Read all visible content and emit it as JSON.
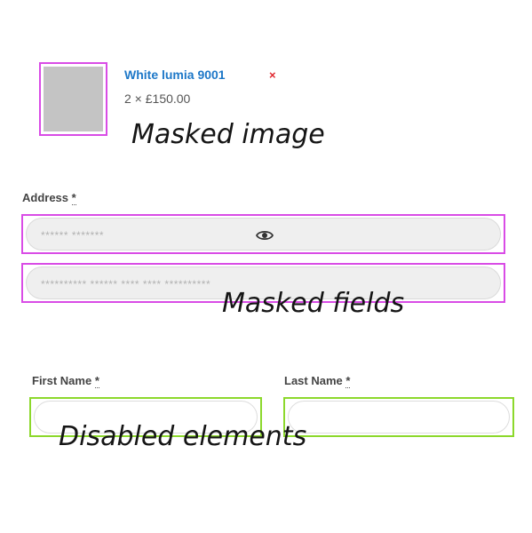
{
  "cart_item": {
    "name": "White lumia 9001",
    "remove_symbol": "×",
    "quantity_price": "2 × £150.00"
  },
  "annotations": {
    "image": "Masked image",
    "fields": "Masked fields",
    "disabled": "Disabled elements"
  },
  "address": {
    "label": "Address",
    "required_marker": "*",
    "line1_placeholder": "****** *******",
    "line2_placeholder": "********** ****** **** **** **********"
  },
  "name_fields": {
    "first_label": "First Name",
    "last_label": "Last Name",
    "required_marker": "*"
  },
  "colors": {
    "masked_outline": "#d94ce6",
    "disabled_outline": "#8cd82c",
    "link_blue": "#1e78c8",
    "remove_red": "#e0262d"
  },
  "icons": {
    "reveal": "eye-icon"
  }
}
